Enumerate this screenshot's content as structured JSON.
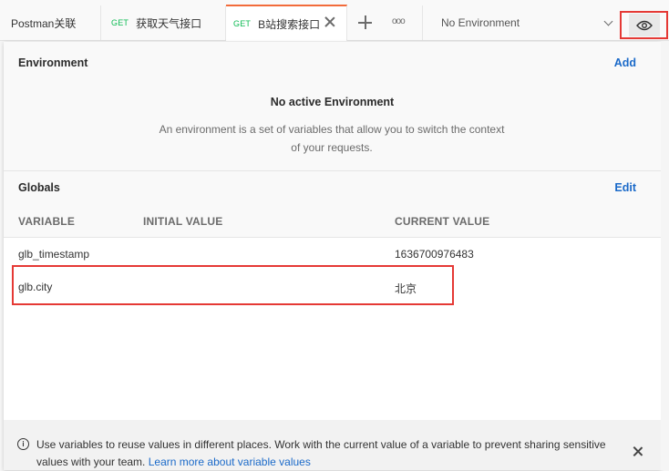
{
  "tabs": [
    {
      "method": "",
      "label": "Postman关联"
    },
    {
      "method": "GET",
      "label": "获取天气接口"
    },
    {
      "method": "GET",
      "label": "B站搜索接口",
      "active": true
    }
  ],
  "environment_selector": {
    "value": "No Environment"
  },
  "icons": {
    "new_tab": "plus-icon",
    "more": "more-horizontal-icon",
    "env_dropdown": "chevron-down-icon",
    "quick_look": "eye-icon",
    "info": "info-icon",
    "dismiss": "close-icon"
  },
  "environment_section": {
    "title": "Environment",
    "action": "Add",
    "empty_title": "No active Environment",
    "empty_description": "An environment is a set of variables that allow you to switch the context of your requests."
  },
  "globals_section": {
    "title": "Globals",
    "action": "Edit",
    "columns": [
      "VARIABLE",
      "INITIAL VALUE",
      "CURRENT VALUE"
    ],
    "rows": [
      {
        "variable": "glb_timestamp",
        "initial": "",
        "current": "1636700976483"
      },
      {
        "variable": "glb.city",
        "initial": "",
        "current": "北京"
      }
    ]
  },
  "info_banner": {
    "text": "Use variables to reuse values in different places. Work with the current value of a variable to prevent sharing sensitive values with your team.",
    "link": "Learn more about variable values"
  },
  "colors": {
    "accent_link": "#1b6ac9",
    "active_tab_border": "#f26b3a",
    "method_get": "#0cbb52",
    "annotation_red": "#e53935"
  }
}
